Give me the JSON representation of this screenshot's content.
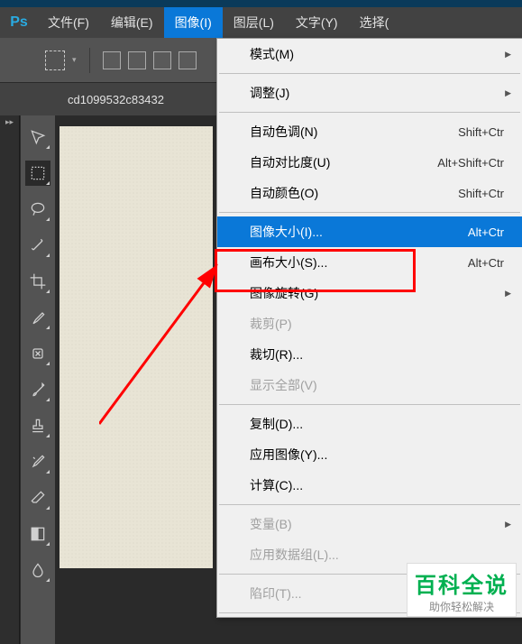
{
  "app": {
    "name": "Ps"
  },
  "menubar": {
    "items": [
      {
        "label": "文件(F)"
      },
      {
        "label": "编辑(E)"
      },
      {
        "label": "图像(I)"
      },
      {
        "label": "图层(L)"
      },
      {
        "label": "文字(Y)"
      },
      {
        "label": "选择("
      }
    ],
    "active_index": 2
  },
  "tab": {
    "title": "cd1099532c83432"
  },
  "dropdown": {
    "groups": [
      [
        {
          "label": "模式(M)",
          "sub": true
        }
      ],
      [
        {
          "label": "调整(J)",
          "sub": true
        }
      ],
      [
        {
          "label": "自动色调(N)",
          "shortcut": "Shift+Ctr"
        },
        {
          "label": "自动对比度(U)",
          "shortcut": "Alt+Shift+Ctr"
        },
        {
          "label": "自动颜色(O)",
          "shortcut": "Shift+Ctr"
        }
      ],
      [
        {
          "label": "图像大小(I)...",
          "shortcut": "Alt+Ctr",
          "highlighted": true
        },
        {
          "label": "画布大小(S)...",
          "shortcut": "Alt+Ctr"
        },
        {
          "label": "图像旋转(G)",
          "sub": true
        },
        {
          "label": "裁剪(P)",
          "disabled": true
        },
        {
          "label": "裁切(R)..."
        },
        {
          "label": "显示全部(V)",
          "disabled": true
        }
      ],
      [
        {
          "label": "复制(D)..."
        },
        {
          "label": "应用图像(Y)..."
        },
        {
          "label": "计算(C)..."
        }
      ],
      [
        {
          "label": "变量(B)",
          "disabled": true,
          "sub": true
        },
        {
          "label": "应用数据组(L)...",
          "disabled": true
        }
      ],
      [
        {
          "label": "陷印(T)...",
          "disabled": true
        }
      ]
    ]
  },
  "watermark": {
    "title": "百科全说",
    "subtitle": "助你轻松解决"
  }
}
